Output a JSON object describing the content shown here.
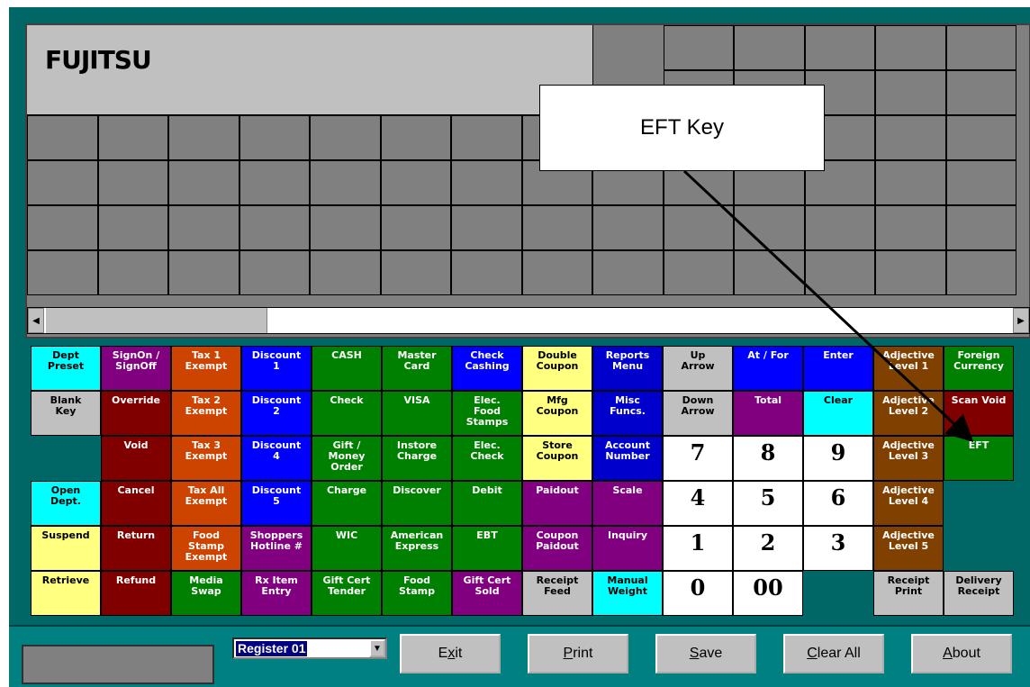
{
  "logo": {
    "text": "FUJITSU"
  },
  "callout": {
    "text": "EFT Key"
  },
  "colors": {
    "cyan": "#00ffff",
    "purple": "#800080",
    "orange": "#cc4400",
    "blue": "#0000ff",
    "green": "#008000",
    "yellow": "#ffff80",
    "navy": "#0000cc",
    "gray": "#c0c0c0",
    "maroon": "#800000",
    "brown": "#804000",
    "teal": "#008080"
  },
  "keys": {
    "dept_preset": "Dept\nPreset",
    "signon": "SignOn /\nSignOff",
    "tax1": "Tax 1\nExempt",
    "discount1": "Discount\n1",
    "cash": "CASH",
    "mastercard": "Master\nCard",
    "check_cashing": "Check\nCashing",
    "double_coupon": "Double\nCoupon",
    "reports_menu": "Reports\nMenu",
    "up_arrow": "Up\nArrow",
    "at_for": "At / For",
    "enter": "Enter",
    "adj1": "Adjective\nLevel 1",
    "foreign_currency": "Foreign\nCurrency",
    "blank_key": "Blank\nKey",
    "override": "Override",
    "tax2": "Tax 2\nExempt",
    "discount2": "Discount\n2",
    "check": "Check",
    "visa": "VISA",
    "elec_food_stamps": "Elec.\nFood\nStamps",
    "mfg_coupon": "Mfg\nCoupon",
    "misc_funcs": "Misc\nFuncs.",
    "down_arrow": "Down\nArrow",
    "total": "Total",
    "clear": "Clear",
    "adj2": "Adjective\nLevel 2",
    "scan_void": "Scan Void",
    "void": "Void",
    "tax3": "Tax 3\nExempt",
    "discount4": "Discount\n4",
    "gift_money_order": "Gift /\nMoney\nOrder",
    "instore_charge": "Instore\nCharge",
    "elec_check": "Elec.\nCheck",
    "store_coupon": "Store\nCoupon",
    "account_number": "Account\nNumber",
    "n7": "7",
    "n8": "8",
    "n9": "9",
    "adj3": "Adjective\nLevel 3",
    "eft": "EFT",
    "open_dept": "Open\nDept.",
    "cancel": "Cancel",
    "tax_all": "Tax All\nExempt",
    "discount5": "Discount\n5",
    "charge": "Charge",
    "discover": "Discover",
    "debit": "Debit",
    "paidout": "Paidout",
    "scale": "Scale",
    "n4": "4",
    "n5": "5",
    "n6": "6",
    "adj4": "Adjective\nLevel 4",
    "suspend": "Suspend",
    "return": "Return",
    "food_stamp_exempt": "Food\nStamp\nExempt",
    "shoppers_hotline": "Shoppers\nHotline #",
    "wic": "WIC",
    "american_express": "American\nExpress",
    "ebt": "EBT",
    "coupon_paidout": "Coupon\nPaidout",
    "inquiry": "Inquiry",
    "n1": "1",
    "n2": "2",
    "n3": "3",
    "adj5": "Adjective\nLevel 5",
    "retrieve": "Retrieve",
    "refund": "Refund",
    "media_swap": "Media\nSwap",
    "rx_item_entry": "Rx Item\nEntry",
    "gift_cert_tender": "Gift Cert\nTender",
    "food_stamp": "Food\nStamp",
    "gift_cert_sold": "Gift Cert\nSold",
    "receipt_feed": "Receipt\nFeed",
    "manual_weight": "Manual\nWeight",
    "n0": "0",
    "n00": "00",
    "receipt_print": "Receipt\nPrint",
    "delivery_receipt": "Delivery\nReceipt"
  },
  "register": {
    "selected": "Register 01"
  },
  "buttons": {
    "exit_pre": "E",
    "exit_u": "x",
    "exit_post": "it",
    "print_pre": "",
    "print_u": "P",
    "print_post": "rint",
    "save_pre": "",
    "save_u": "S",
    "save_post": "ave",
    "clear_pre": "",
    "clear_u": "C",
    "clear_post": "lear All",
    "about_pre": "",
    "about_u": "A",
    "about_post": "bout"
  }
}
